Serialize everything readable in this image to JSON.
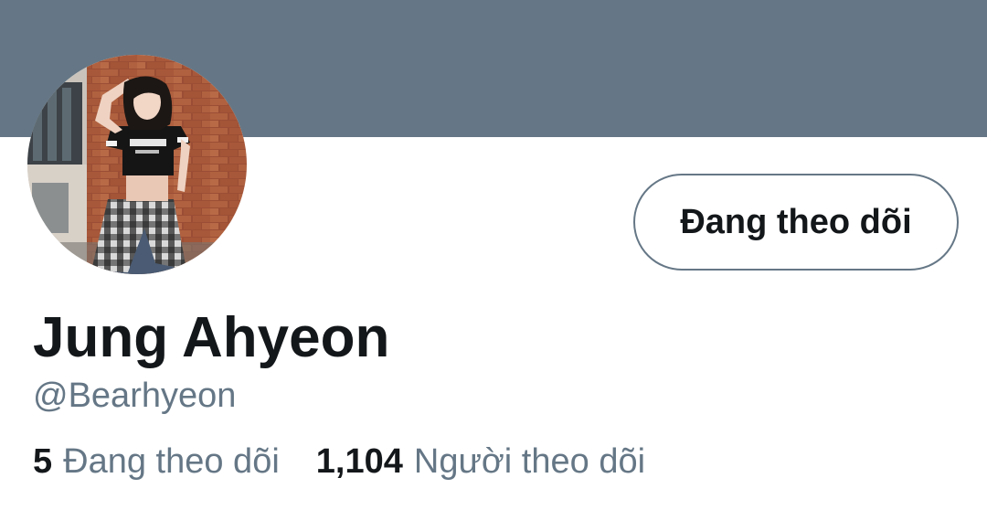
{
  "profile": {
    "banner_color": "#657786",
    "avatar_icon": "profile-photo",
    "display_name": "Jung Ahyeon",
    "handle": "@Bearhyeon",
    "follow_button_label": "Đang theo dõi",
    "stats": {
      "following_count": "5",
      "following_label": "Đang theo dõi",
      "followers_count": "1,104",
      "followers_label": "Người theo dõi"
    }
  },
  "colors": {
    "primary_text": "#14171a",
    "secondary_text": "#657786",
    "background": "#ffffff"
  }
}
